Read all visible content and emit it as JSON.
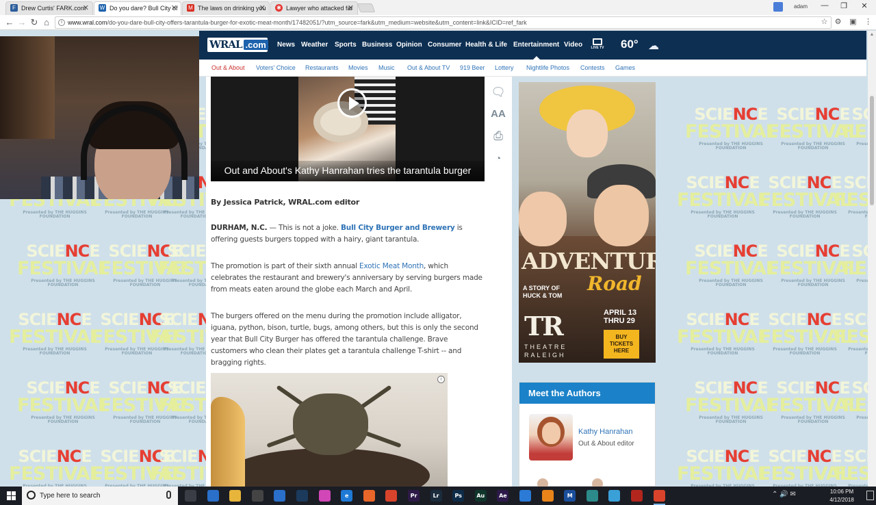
{
  "browser": {
    "tabs": [
      {
        "title": "Drew Curtis' FARK.com",
        "favicon": "fark-icon",
        "active": false
      },
      {
        "title": "Do you dare? Bull City of",
        "favicon": "wral-icon",
        "active": true
      },
      {
        "title": "The laws on drinking you",
        "favicon": "gmail-icon",
        "active": false
      },
      {
        "title": "Lawyer who attacked far",
        "favicon": "cbc-icon",
        "active": false
      }
    ],
    "profile_name": "adam",
    "address": {
      "host": "www.wral.com",
      "path": "/do-you-dare-bull-city-offers-tarantula-burger-for-exotic-meat-month/17482051/?utm_source=fark&utm_medium=website&utm_content=link&ICID=ref_fark"
    }
  },
  "site": {
    "logo_main": "WRAL",
    "logo_dot": ".com",
    "nav": [
      "News",
      "Weather",
      "Sports",
      "Business",
      "Opinion",
      "Consumer",
      "Health & Life",
      "Entertainment",
      "Video"
    ],
    "nav_active": "Entertainment",
    "live_tv": "LIVE TV",
    "temperature": "60°",
    "subnav": [
      "Out & About",
      "Voters' Choice",
      "Restaurants",
      "Movies",
      "Music",
      "Out & About TV",
      "919 Beer",
      "Lottery",
      "Nightlife Photos",
      "Contests",
      "Games"
    ],
    "subnav_current": "Out & About"
  },
  "background": {
    "line1_a": "SCIE",
    "line1_b": "NC",
    "line1_c": "E",
    "line2": "FESTIVAL",
    "line3": "Presented by THE HUGGINS FOUNDATION"
  },
  "article": {
    "video_caption": "Out and About's Kathy Hanrahan tries the tarantula burger",
    "byline": "By Jessica Patrick, WRAL.com editor",
    "p1_location": "DURHAM, N.C.",
    "p1_dash": " — This is not a joke. ",
    "p1_link": "Bull City Burger and Brewery",
    "p1_rest": " is offering guests burgers topped with a hairy, giant tarantula.",
    "p2_start": "The promotion is part of their sixth annual ",
    "p2_link": "Exotic Meat Month",
    "p2_rest": ", which celebrates the restaurant and brewery's anniversary by serving burgers made from meats eaten around the globe each March and April.",
    "p3": "The burgers offered on the menu during the promotion include alligator, iguana, python, bison, turtle, bugs, among others, but this is only the second year that Bull City Burger has offered the tarantula challenge. Brave customers who clean their plates get a tarantula challenge T-shirt -- and bragging rights."
  },
  "ad": {
    "title": "ADVENTURE",
    "title_script": "Road",
    "subtitle_1": "A STORY OF",
    "subtitle_2": "HUCK & TOM",
    "theatre_logo": "TR",
    "theatre_name": "THEATRE RALEIGH",
    "dates_1": "APRIL 13",
    "dates_2": "THRU 29",
    "buy_1": "BUY",
    "buy_2": "TICKETS",
    "buy_3": "HERE"
  },
  "authors": {
    "heading": "Meet the Authors",
    "name": "Kathy Hanrahan",
    "role": "Out & About editor"
  },
  "taskbar": {
    "search_placeholder": "Type here to search",
    "time": "10:06 PM",
    "date": "4/12/2018",
    "apps": [
      {
        "name": "task-view-icon",
        "label": "",
        "color": "#3a3d46"
      },
      {
        "name": "outlook-icon",
        "label": "",
        "color": "#2a6fc9"
      },
      {
        "name": "file-explorer-icon",
        "label": "",
        "color": "#e8b53b"
      },
      {
        "name": "photos-icon",
        "label": "",
        "color": "#444"
      },
      {
        "name": "paint-icon",
        "label": "",
        "color": "#2a6fc9"
      },
      {
        "name": "steam-icon",
        "label": "",
        "color": "#1b3a5c"
      },
      {
        "name": "itunes-icon",
        "label": "",
        "color": "#d147b7"
      },
      {
        "name": "edge-icon",
        "label": "e",
        "color": "#1f7ad6"
      },
      {
        "name": "firefox-icon",
        "label": "",
        "color": "#e8662a"
      },
      {
        "name": "chrome-icon",
        "label": "",
        "color": "#d8432c"
      },
      {
        "name": "premiere-icon",
        "label": "Pr",
        "color": "#2e1a47"
      },
      {
        "name": "lightroom-icon",
        "label": "Lr",
        "color": "#1b2c3d"
      },
      {
        "name": "photoshop-icon",
        "label": "Ps",
        "color": "#0e2b47"
      },
      {
        "name": "audition-icon",
        "label": "Au",
        "color": "#10362c"
      },
      {
        "name": "after-effects-icon",
        "label": "Ae",
        "color": "#2d1a4a"
      },
      {
        "name": "dropbox-icon",
        "label": "",
        "color": "#2a7ad6"
      },
      {
        "name": "vlc-icon",
        "label": "",
        "color": "#e8841a"
      },
      {
        "name": "malwarebytes-icon",
        "label": "M",
        "color": "#1b4f9c"
      },
      {
        "name": "screen-recorder-icon",
        "label": "",
        "color": "#2c8a8a"
      },
      {
        "name": "droplet-icon",
        "label": "",
        "color": "#3aa0d8"
      },
      {
        "name": "filezilla-icon",
        "label": "",
        "color": "#b3261e"
      },
      {
        "name": "chrome-running-icon",
        "label": "",
        "color": "#d8432c"
      }
    ]
  }
}
